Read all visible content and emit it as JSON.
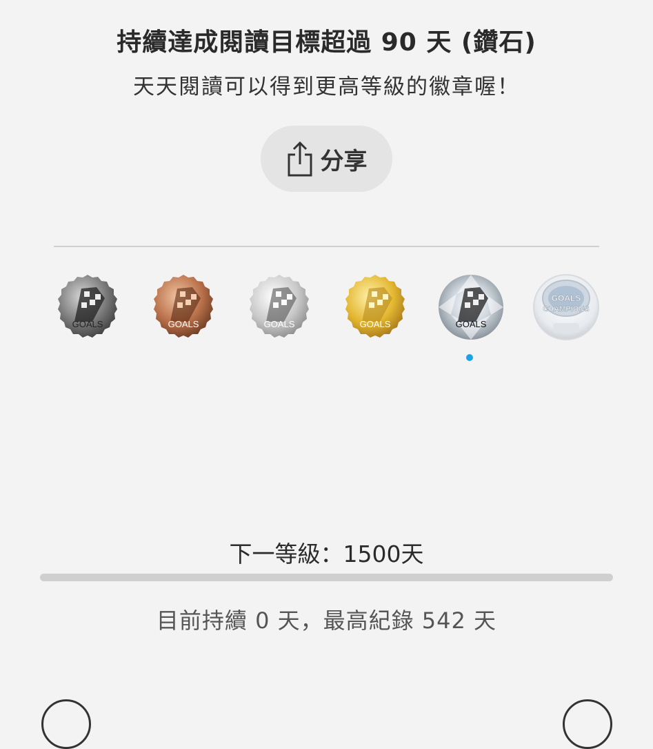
{
  "header": {
    "title": "持續達成閱讀目標超過 90 天 (鑽石)",
    "subtitle": "天天閱讀可以得到更高等級的徽章喔！"
  },
  "share": {
    "label": "分享",
    "icon": "share-icon"
  },
  "badges": {
    "items": [
      {
        "name": "dark-silver",
        "text": "GOALS",
        "color": "#6e6e6e"
      },
      {
        "name": "bronze",
        "text": "GOALS",
        "color": "#b8704a"
      },
      {
        "name": "silver",
        "text": "GOALS",
        "color": "#c9c9c9"
      },
      {
        "name": "gold",
        "text": "GOALS",
        "color": "#e3b631"
      },
      {
        "name": "diamond",
        "text": "GOALS",
        "color": "#cfd6de",
        "selected": true
      },
      {
        "name": "champions",
        "text": "GOALS",
        "text2": "CHAMPIONS",
        "color": "#e8ebef"
      }
    ],
    "selected_index": 4,
    "indicator_color": "#1aa3e8"
  },
  "progress": {
    "next_level_label": "下一等級：1500天",
    "fraction": 0,
    "record_text": "目前持續 0 天，最高紀錄 542 天"
  }
}
